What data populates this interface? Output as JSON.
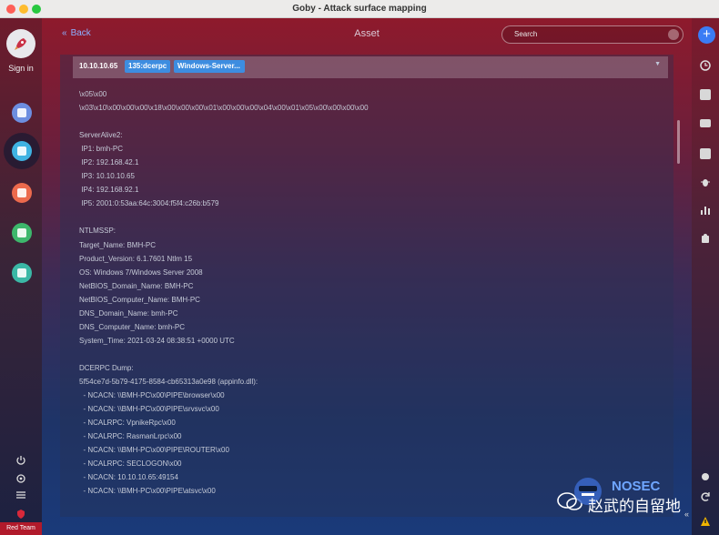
{
  "window": {
    "title": "Goby - Attack surface mapping"
  },
  "leftbar": {
    "signin_label": "Sign in",
    "team_badge": "Red Team",
    "nav_colors": [
      "#6d8ee0",
      "#3fb3e2",
      "#ec6a4d",
      "#3db76c",
      "#3bb8a6"
    ]
  },
  "header": {
    "back_label": "Back",
    "title": "Asset",
    "search_placeholder": "Search"
  },
  "asset": {
    "ip": "10.10.10.65",
    "tags": [
      "135:dcerpc",
      "Windows-Server..."
    ]
  },
  "content": {
    "lines": [
      "\\x05\\x00",
      "\\x03\\x10\\x00\\x00\\x00\\x18\\x00\\x00\\x00\\x01\\x00\\x00\\x00\\x04\\x00\\x01\\x05\\x00\\x00\\x00\\x00",
      "",
      "ServerAlive2:",
      " IP1: bmh-PC",
      " IP2: 192.168.42.1",
      " IP3: 10.10.10.65",
      " IP4: 192.168.92.1",
      " IP5: 2001:0:53aa:64c:3004:f5f4:c26b:b579",
      "",
      "NTLMSSP:",
      "Target_Name: BMH-PC",
      "Product_Version: 6.1.7601 Ntlm 15",
      "OS: Windows 7/Windows Server 2008",
      "NetBIOS_Domain_Name: BMH-PC",
      "NetBIOS_Computer_Name: BMH-PC",
      "DNS_Domain_Name: bmh-PC",
      "DNS_Computer_Name: bmh-PC",
      "System_Time: 2021-03-24 08:38:51 +0000 UTC",
      "",
      "DCERPC Dump:",
      "5f54ce7d-5b79-4175-8584-cb65313a0e98 (appinfo.dll):",
      "  - NCACN: \\\\BMH-PC\\x00\\PIPE\\browser\\x00",
      "  - NCACN: \\\\BMH-PC\\x00\\PIPE\\srvsvc\\x00",
      "  - NCALRPC: VpnikeRpc\\x00",
      "  - NCALRPC: RasmanLrpc\\x00",
      "  - NCACN: \\\\BMH-PC\\x00\\PIPE\\ROUTER\\x00",
      "  - NCALRPC: SECLOGON\\x00",
      "  - NCACN: 10.10.10.65:49154",
      "  - NCACN: \\\\BMH-PC\\x00\\PIPE\\atsvc\\x00"
    ]
  },
  "watermark": {
    "brand": "NOSEC",
    "caption": "赵武的自留地"
  }
}
